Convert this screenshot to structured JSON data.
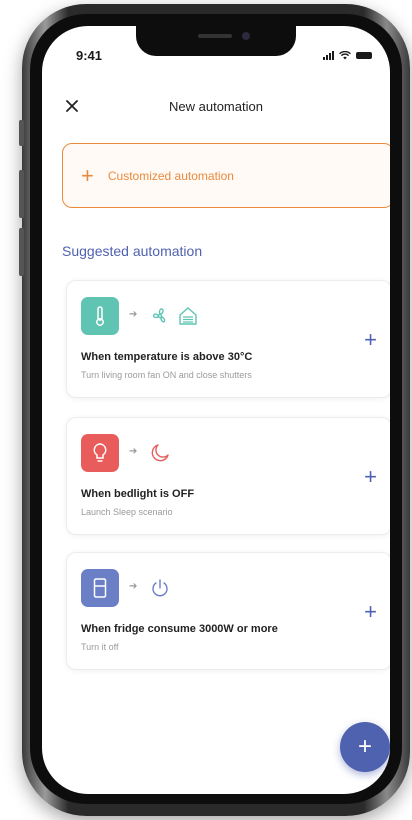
{
  "status_bar": {
    "time": "9:41"
  },
  "header": {
    "title": "New automation",
    "close_icon": "close-icon"
  },
  "custom_button": {
    "plus": "+",
    "label": "Customized automation"
  },
  "section": {
    "title": "Suggested automation"
  },
  "cards": [
    {
      "title": "When temperature is above 30°C",
      "subtitle": "Turn living room fan ON and close shutters",
      "add_label": "+",
      "trigger_icon": "thermometer-icon",
      "trigger_color": "#5fc4b2",
      "output_icons": [
        "fan-icon",
        "shutter-icon"
      ],
      "output_color": "#5fc4b2"
    },
    {
      "title": "When bedlight is OFF",
      "subtitle": "Launch Sleep scenario",
      "add_label": "+",
      "trigger_icon": "lightbulb-icon",
      "trigger_color": "#e85c5c",
      "output_icons": [
        "moon-icon"
      ],
      "output_color": "#e85c5c"
    },
    {
      "title": "When fridge consume 3000W or more",
      "subtitle": "Turn it off",
      "add_label": "+",
      "trigger_icon": "fridge-icon",
      "trigger_color": "#6b7fc6",
      "output_icons": [
        "power-icon"
      ],
      "output_color": "#6b7fc6"
    }
  ],
  "fab": {
    "label": "+"
  },
  "colors": {
    "accent_blue": "#4f62b0",
    "accent_orange": "#e98a3c"
  }
}
